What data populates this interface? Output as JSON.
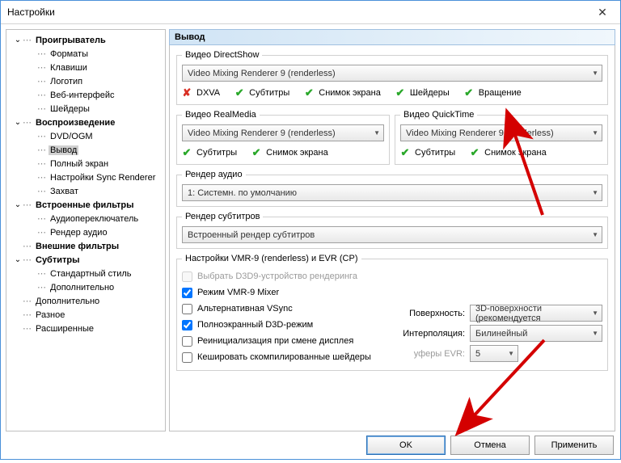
{
  "window": {
    "title": "Настройки",
    "close_glyph": "✕"
  },
  "tree": [
    {
      "label": "Проигрыватель",
      "bold": true,
      "exp": true,
      "indent": 0
    },
    {
      "label": "Форматы",
      "indent": 1
    },
    {
      "label": "Клавиши",
      "indent": 1
    },
    {
      "label": "Логотип",
      "indent": 1
    },
    {
      "label": "Веб-интерфейс",
      "indent": 1
    },
    {
      "label": "Шейдеры",
      "indent": 1
    },
    {
      "label": "Воспроизведение",
      "bold": true,
      "exp": true,
      "indent": 0
    },
    {
      "label": "DVD/OGM",
      "indent": 1
    },
    {
      "label": "Вывод",
      "indent": 1,
      "sel": true
    },
    {
      "label": "Полный экран",
      "indent": 1
    },
    {
      "label": "Настройки Sync Renderer",
      "indent": 1
    },
    {
      "label": "Захват",
      "indent": 1
    },
    {
      "label": "Встроенные фильтры",
      "bold": true,
      "exp": true,
      "indent": 0
    },
    {
      "label": "Аудиопереключатель",
      "indent": 1
    },
    {
      "label": "Рендер аудио",
      "indent": 1
    },
    {
      "label": "Внешние фильтры",
      "bold": true,
      "indent": 0
    },
    {
      "label": "Субтитры",
      "bold": true,
      "exp": true,
      "indent": 0
    },
    {
      "label": "Стандартный стиль",
      "indent": 1
    },
    {
      "label": "Дополнительно",
      "indent": 1
    },
    {
      "label": "Дополнительно",
      "indent": 0
    },
    {
      "label": "Разное",
      "indent": 0
    },
    {
      "label": "Расширенные",
      "indent": 0
    }
  ],
  "main": {
    "title": "Вывод",
    "directshow": {
      "legend": "Видео DirectShow",
      "value": "Video Mixing Renderer 9 (renderless)",
      "caps": [
        {
          "ok": false,
          "label": "DXVA"
        },
        {
          "ok": true,
          "label": "Субтитры"
        },
        {
          "ok": true,
          "label": "Снимок экрана"
        },
        {
          "ok": true,
          "label": "Шейдеры"
        },
        {
          "ok": true,
          "label": "Вращение"
        }
      ]
    },
    "realmedia": {
      "legend": "Видео RealMedia",
      "value": "Video Mixing Renderer 9 (renderless)",
      "caps": [
        {
          "ok": true,
          "label": "Субтитры"
        },
        {
          "ok": true,
          "label": "Снимок экрана"
        }
      ]
    },
    "quicktime": {
      "legend": "Видео QuickTime",
      "value": "Video Mixing Renderer 9 (renderless)",
      "caps": [
        {
          "ok": true,
          "label": "Субтитры"
        },
        {
          "ok": true,
          "label": "Снимок экрана"
        }
      ]
    },
    "audio": {
      "legend": "Рендер аудио",
      "value": "1: Системн. по умолчанию"
    },
    "subs": {
      "legend": "Рендер субтитров",
      "value": "Встроенный рендер субтитров"
    },
    "vmr9": {
      "legend": "Настройки VMR-9 (renderless) и EVR (CP)",
      "checks": [
        {
          "label": "Выбрать D3D9-устройство рендеринга",
          "checked": false,
          "disabled": true
        },
        {
          "label": "Режим VMR-9 Mixer",
          "checked": true
        },
        {
          "label": "Альтернативная VSync",
          "checked": false
        },
        {
          "label": "Полноэкранный D3D-режим",
          "checked": true
        },
        {
          "label": "Реинициализация при смене дисплея",
          "checked": false
        },
        {
          "label": "Кешировать скомпилированные шейдеры",
          "checked": false
        }
      ],
      "d3d9_combo": "",
      "surface": {
        "label": "Поверхность:",
        "value": "3D-поверхности (рекомендуется"
      },
      "interpolation": {
        "label": "Интерполяция:",
        "value": "Билинейный"
      },
      "evr_buffers": {
        "label": "уферы EVR:",
        "value": "5"
      }
    }
  },
  "footer": {
    "ok": "OK",
    "cancel": "Отмена",
    "apply": "Применить"
  }
}
